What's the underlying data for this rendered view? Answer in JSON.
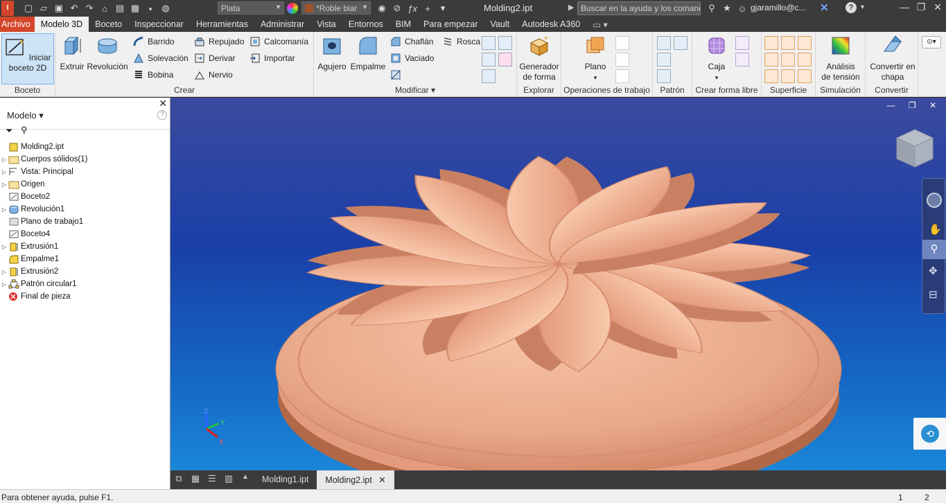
{
  "titlebar": {
    "material": "Plata",
    "appearance": "*Roble blar",
    "document_title": "Molding2.ipt",
    "help_search_placeholder": "Buscar en la ayuda y los comand",
    "user": "gjaramillo@c..."
  },
  "menu_tabs": [
    "Archivo",
    "Modelo 3D",
    "Boceto",
    "Inspeccionar",
    "Herramientas",
    "Administrar",
    "Vista",
    "Entornos",
    "BIM",
    "Para empezar",
    "Vault",
    "Autodesk A360"
  ],
  "ribbon": {
    "boceto": {
      "title": "Boceto",
      "start_sketch": "Iniciar boceto 2D"
    },
    "crear": {
      "title": "Crear",
      "extruir": "Extruir",
      "revolucion": "Revolución",
      "barrido": "Barrido",
      "solevacion": "Solevación",
      "bobina": "Bobina",
      "repujado": "Repujado",
      "derivar": "Derivar",
      "nervio": "Nervio",
      "calcomania": "Calcomanía",
      "importar": "Importar"
    },
    "modificar": {
      "title": "Modificar",
      "agujero": "Agujero",
      "empalme": "Empalme",
      "chaflan": "Chaflán",
      "rosca": "Rosca",
      "vaciado": "Vaciado"
    },
    "explorar": {
      "title": "Explorar",
      "generador_l1": "Generador",
      "generador_l2": "de forma"
    },
    "operaciones": {
      "title": "Operaciones de trabajo",
      "plano": "Plano"
    },
    "patron": {
      "title": "Patrón"
    },
    "forma_libre": {
      "title": "Crear forma libre",
      "caja": "Caja"
    },
    "superficie": {
      "title": "Superficie"
    },
    "simulacion": {
      "title": "Simulación",
      "analisis_l1": "Análisis",
      "analisis_l2": "de tensión"
    },
    "convertir": {
      "title": "Convertir",
      "chapa_l1": "Convertir en",
      "chapa_l2": "chapa"
    }
  },
  "browser": {
    "title": "Modelo",
    "nodes": [
      {
        "label": "Molding2.ipt"
      },
      {
        "label": "Cuerpos sólidos(1)"
      },
      {
        "label": "Vista: Principal"
      },
      {
        "label": "Origen"
      },
      {
        "label": "Boceto2"
      },
      {
        "label": "Revolución1"
      },
      {
        "label": "Plano de trabajo1"
      },
      {
        "label": "Boceto4"
      },
      {
        "label": "Extrusión1"
      },
      {
        "label": "Empalme1"
      },
      {
        "label": "Extrusión2"
      },
      {
        "label": "Patrón circular1"
      },
      {
        "label": "Final de pieza"
      }
    ]
  },
  "doc_tabs": [
    "Molding1.ipt",
    "Molding2.ipt"
  ],
  "status": {
    "help": "Para obtener ayuda, pulse F1.",
    "n1": "1",
    "n2": "2"
  },
  "colors": {
    "file_tab": "#d4462a",
    "viewport_top": "#3b4a9e",
    "viewport_bottom": "#1a86d8",
    "part": "#e9a88a"
  }
}
